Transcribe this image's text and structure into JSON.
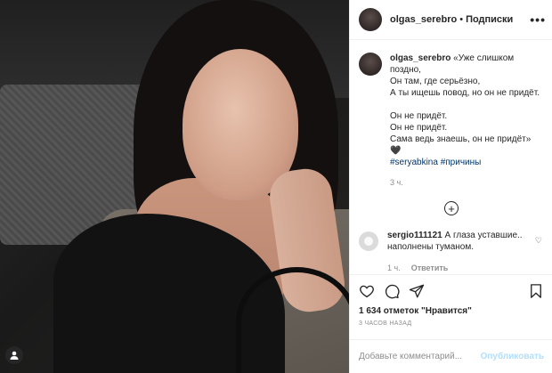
{
  "post": {
    "username": "olgas_serebro",
    "dot": "•",
    "follow_label": "Подписки",
    "more_icon": "more-dots-icon"
  },
  "caption": {
    "username": "olgas_serebro",
    "lines": [
      "«Уже слишком поздно,",
      "Он там, где серьёзно,",
      "А ты ищешь повод, но он не придёт.",
      "",
      "Он не придёт.",
      "Он не придёт.",
      "Сама ведь знаешь, он не придёт» 🖤"
    ],
    "hashtags": "#seryabkina #причины",
    "time": "3 ч."
  },
  "comment": {
    "username": "sergio111121",
    "text": "А глаза уставшие.. наполнены туманом.",
    "time": "1 ч.",
    "reply_label": "Ответить"
  },
  "stats": {
    "likes": "1 634 отметок \"Нравится\"",
    "ago": "3 ЧАСОВ НАЗАД"
  },
  "composer": {
    "placeholder": "Добавьте комментарий...",
    "post_label": "Опубликовать"
  }
}
